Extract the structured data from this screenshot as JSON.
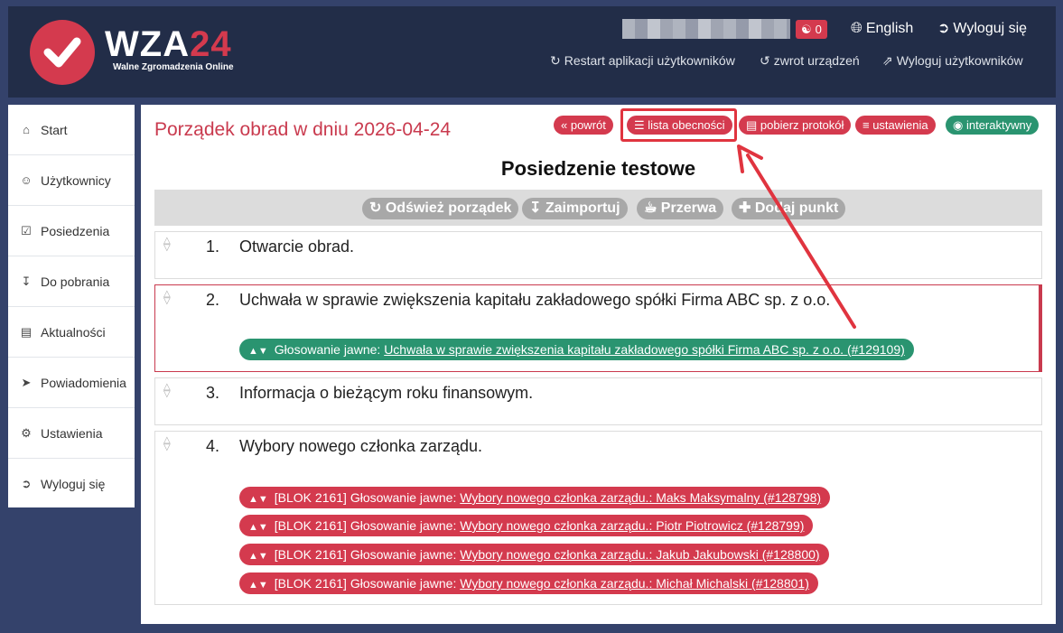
{
  "header": {
    "logo_main": "WZA",
    "logo_accent": "24",
    "logo_sub": "Walne Zgromadzenia Online",
    "user_count": "0",
    "language": "English",
    "logout": "Wyloguj się",
    "links": [
      {
        "label": "Restart aplikacji użytkowników",
        "icon": "refresh-icon"
      },
      {
        "label": "zwrot urządzeń",
        "icon": "undo-icon"
      },
      {
        "label": "Wyloguj użytkowników",
        "icon": "external-icon"
      }
    ]
  },
  "sidebar": {
    "items": [
      {
        "label": "Start",
        "icon": "home-icon"
      },
      {
        "label": "Użytkownicy",
        "icon": "users-icon"
      },
      {
        "label": "Posiedzenia",
        "icon": "calendar-icon"
      },
      {
        "label": "Do pobrania",
        "icon": "download-icon"
      },
      {
        "label": "Aktualności",
        "icon": "news-icon"
      },
      {
        "label": "Powiadomienia",
        "icon": "send-icon"
      },
      {
        "label": "Ustawienia",
        "icon": "gears-icon"
      },
      {
        "label": "Wyloguj się",
        "icon": "logout-icon"
      }
    ]
  },
  "main": {
    "title": "Porządek obrad w dniu 2026-04-24",
    "pills": {
      "back": "powrót",
      "attendance": "lista obecności",
      "protocol": "pobierz protokół",
      "settings": "ustawienia",
      "interactive": "interaktywny"
    },
    "meeting_title": "Posiedzenie testowe",
    "toolbar": {
      "refresh": "Odśwież porządek",
      "import": "Zaimportuj",
      "break": "Przerwa",
      "add": "Dodaj punkt"
    },
    "agenda": [
      {
        "num": "1.",
        "text": "Otwarcie obrad."
      },
      {
        "num": "2.",
        "text": "Uchwała w sprawie zwiększenia kapitału zakładowego spółki Firma ABC sp. z o.o.",
        "votes": [
          {
            "prefix": "Głosowanie jawne:",
            "link": "Uchwała w sprawie zwiększenia kapitału zakładowego spółki Firma ABC sp. z o.o. (#129109)"
          }
        ]
      },
      {
        "num": "3.",
        "text": "Informacja o bieżącym roku finansowym."
      },
      {
        "num": "4.",
        "text": "Wybory nowego członka zarządu.",
        "votes": [
          {
            "prefix": "[BLOK 2161] Głosowanie jawne:",
            "link": "Wybory nowego członka zarządu.: Maks Maksymalny (#128798)"
          },
          {
            "prefix": "[BLOK 2161] Głosowanie jawne:",
            "link": "Wybory nowego członka zarządu.: Piotr Piotrowicz (#128799)"
          },
          {
            "prefix": "[BLOK 2161] Głosowanie jawne:",
            "link": "Wybory nowego członka zarządu.: Jakub Jakubowski (#128800)"
          },
          {
            "prefix": "[BLOK 2161] Głosowanie jawne:",
            "link": "Wybory nowego członka zarządu.: Michał Michalski (#128801)"
          }
        ]
      }
    ]
  },
  "colors": {
    "brand_red": "#d43a4e",
    "green": "#2a9470",
    "header_bg": "#222d48",
    "page_bg": "#34426b"
  }
}
